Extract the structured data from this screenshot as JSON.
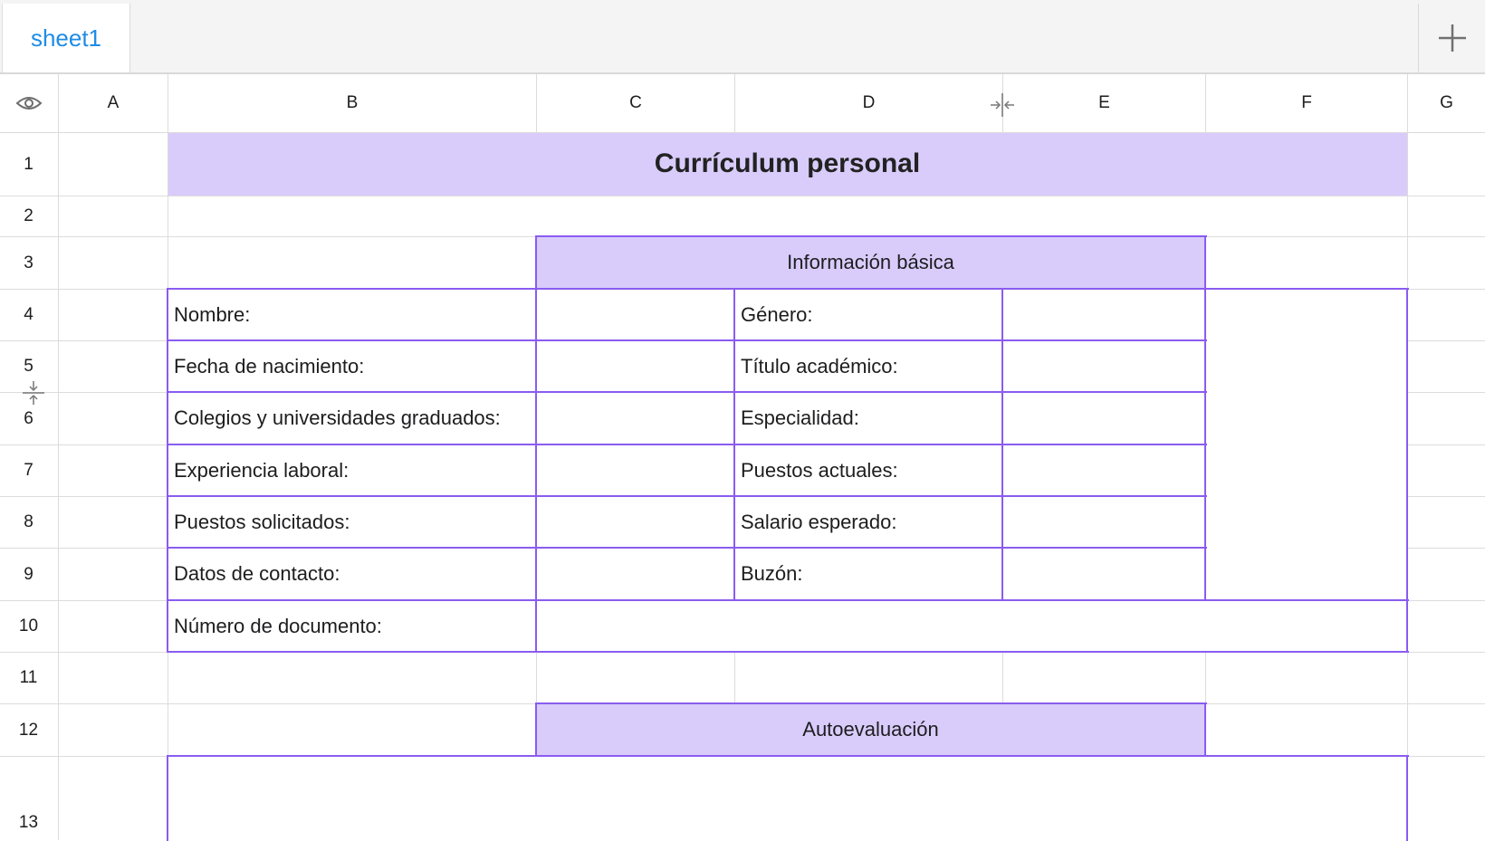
{
  "tabs": [
    {
      "label": "sheet1",
      "active": true
    }
  ],
  "add_sheet_icon": "plus-icon",
  "corner_icon": "eye-icon",
  "columns": [
    "A",
    "B",
    "C",
    "D",
    "E",
    "F",
    "G"
  ],
  "rows": [
    "1",
    "2",
    "3",
    "4",
    "5",
    "6",
    "7",
    "8",
    "9",
    "10",
    "11",
    "12",
    "13"
  ],
  "sheet": {
    "title": "Currículum personal",
    "section_basic": "Información básica",
    "section_self": "Autoevaluación",
    "fields_left": [
      "Nombre:",
      "Fecha de nacimiento:",
      "Colegios y universidades graduados:",
      "Experiencia laboral:",
      "Puestos solicitados:",
      "Datos de contacto:",
      "Número de documento:"
    ],
    "fields_right": [
      "Género:",
      "Título académico:",
      "Especialidad:",
      "Puestos actuales:",
      "Salario esperado:",
      "Buzón:"
    ]
  },
  "colors": {
    "accent_tab": "#1e8ce6",
    "header_fill": "#d9ccfb",
    "border_purple": "#8a5cf0",
    "gridline": "#dcdcdc"
  }
}
